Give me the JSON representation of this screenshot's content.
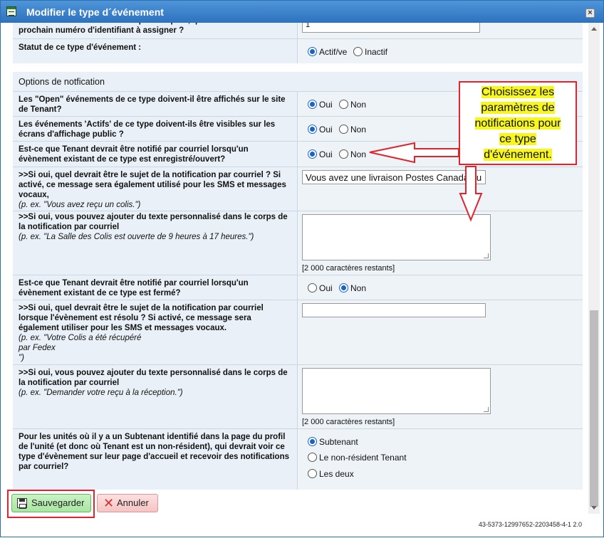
{
  "window": {
    "title": "Modifier le type d´événement",
    "close_label": "×"
  },
  "top_rows": {
    "partial_question": "Si vous désirez utiliser un compteur séparé, quel doit être le prochain numéro d'identifiant à assigner ?",
    "partial_value": "1",
    "status_question": "Statut de ce type d'événement :",
    "status_options": [
      "Actif/ve",
      "Inactif"
    ],
    "status_selected": "Actif/ve"
  },
  "notification": {
    "section_title": "Options de notfication",
    "yes": "Oui",
    "no": "Non",
    "rows": [
      {
        "question": "Les \"Open\" événements de ce type doivent-il être affichés sur le site de Tenant?",
        "selected": "Oui"
      },
      {
        "question": "Les événements 'Actifs' de ce type doivent-ils être visibles sur les écrans d'affichage public ?",
        "selected": "Oui"
      },
      {
        "question": "Est-ce que Tenant devrait être notifié par courriel lorsqu'un évènement existant de ce type est enregistré/ouvert?",
        "selected": "Oui"
      }
    ],
    "open_subject": {
      "question": ">>Si oui, quel devrait être le sujet de la notification par courriel ? Si activé, ce message sera également utilisé pour les SMS et messages vocaux,",
      "example": "(p. ex. \"Vous avez reçu un colis.\")",
      "value": "Vous avez une livraison Postes Canada qu"
    },
    "open_body": {
      "question": ">>Si oui, vous pouvez ajouter du texte personnalisé dans le corps de la notification par courriel",
      "example": "(p. ex. \"La Salle des Colis est ouverte de 9 heures à 17 heures.\")",
      "remaining": "[2 000 caractères restants]"
    },
    "closed": {
      "question": "Est-ce que Tenant devrait être notifié par courriel lorsqu'un évènement existant de ce type est fermé?",
      "selected": "Non"
    },
    "closed_subject": {
      "question": ">>Si oui, quel devrait être le sujet de la notification par courriel lorsque l'évènement est résolu ? Si activé, ce message sera également utiliser pour les SMS et messages vocaux.",
      "example_line1": "(p. ex. \"Votre Colis a été récupéré",
      "example_line2": "par Fedex",
      "example_line3": "\")",
      "value": ""
    },
    "closed_body": {
      "question": ">>Si oui, vous pouvez ajouter du texte personnalisé dans le corps de la notification par courriel",
      "example": "(p. ex. \"Demander votre reçu à la réception.\")",
      "remaining": "[2 000 caractères restants]"
    },
    "subtenant": {
      "question": "Pour les unités où il y a un Subtenant identifié dans la page du profil de l'unité (et donc où Tenant est un non-résident), qui devrait voir ce type d'évènement sur leur page d'accueil et recevoir des notifications par courriel?",
      "options": [
        "Subtenant",
        "Le non-résident Tenant",
        "Les deux"
      ],
      "selected": "Subtenant"
    }
  },
  "callout": {
    "lines": [
      "Choisissez les",
      "paramètres de",
      "notifications pour",
      "ce type",
      "d'événement."
    ],
    "color": "#e0232d",
    "highlight": "#f7f71e"
  },
  "footer": {
    "save_label": "Sauvegarder",
    "cancel_label": "Annuler",
    "version": "43-5373-12997652-2203458-4-1 2.0"
  }
}
